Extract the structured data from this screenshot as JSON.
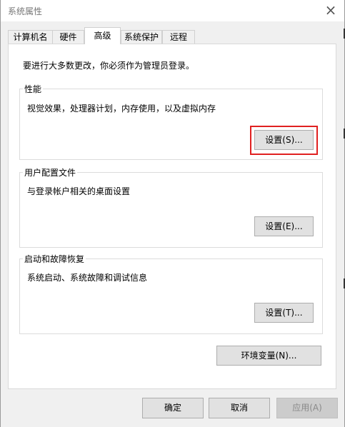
{
  "window": {
    "title": "系统属性",
    "close_glyph": "×"
  },
  "tabs": [
    {
      "label": "计算机名",
      "active": false
    },
    {
      "label": "硬件",
      "active": false
    },
    {
      "label": "高级",
      "active": true
    },
    {
      "label": "系统保护",
      "active": false
    },
    {
      "label": "远程",
      "active": false
    }
  ],
  "panel": {
    "intro": "要进行大多数更改，你必须作为管理员登录。",
    "performance": {
      "title": "性能",
      "description": "视觉效果，处理器计划，内存使用，以及虚拟内存",
      "button": "设置(S)..."
    },
    "user_profiles": {
      "title": "用户配置文件",
      "description": "与登录帐户相关的桌面设置",
      "button": "设置(E)..."
    },
    "startup_recovery": {
      "title": "启动和故障恢复",
      "description": "系统启动、系统故障和调试信息",
      "button": "设置(T)..."
    },
    "env_button": "环境变量(N)..."
  },
  "footer": {
    "ok": "确定",
    "cancel": "取消",
    "apply": "应用(A)"
  },
  "colors": {
    "highlight": "#e02020",
    "dialog_bg": "#f0f0f0",
    "button_bg": "#e1e1e1"
  }
}
